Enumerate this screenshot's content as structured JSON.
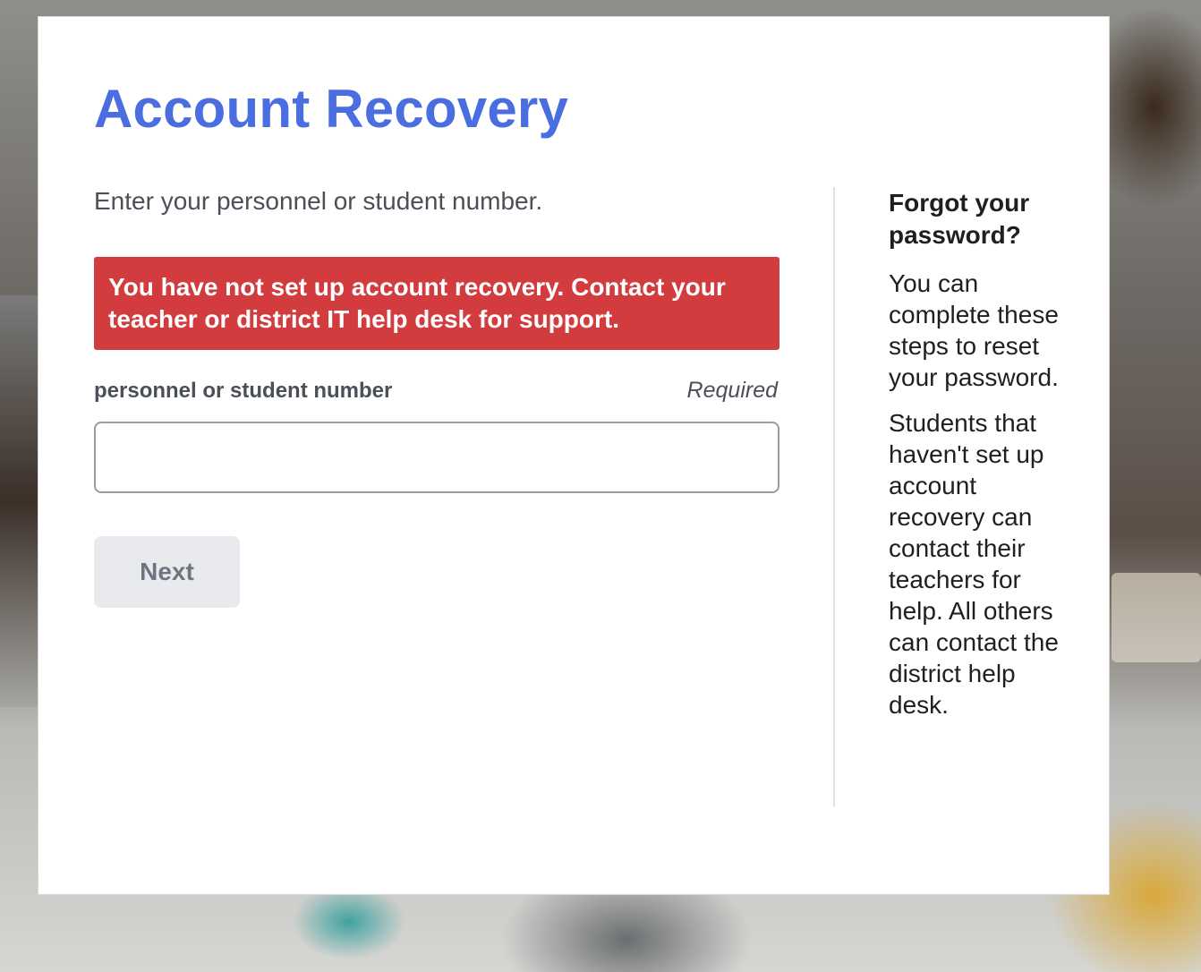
{
  "page": {
    "title": "Account Recovery",
    "instruction": "Enter your personnel or student number."
  },
  "alert": {
    "message": "You have not set up account recovery. Contact your teacher or district IT help desk for support."
  },
  "form": {
    "field_label": "personnel or student number",
    "required_text": "Required",
    "input_value": "",
    "next_label": "Next"
  },
  "help": {
    "heading": "Forgot your password?",
    "paragraph1": "You can complete these steps to reset your password.",
    "paragraph2": "Students that haven't set up account recovery can contact their teachers for help. All others can contact the district help desk."
  },
  "colors": {
    "title": "#4a6ee0",
    "alert_bg": "#d23c3f",
    "button_bg": "#e9eaed"
  }
}
